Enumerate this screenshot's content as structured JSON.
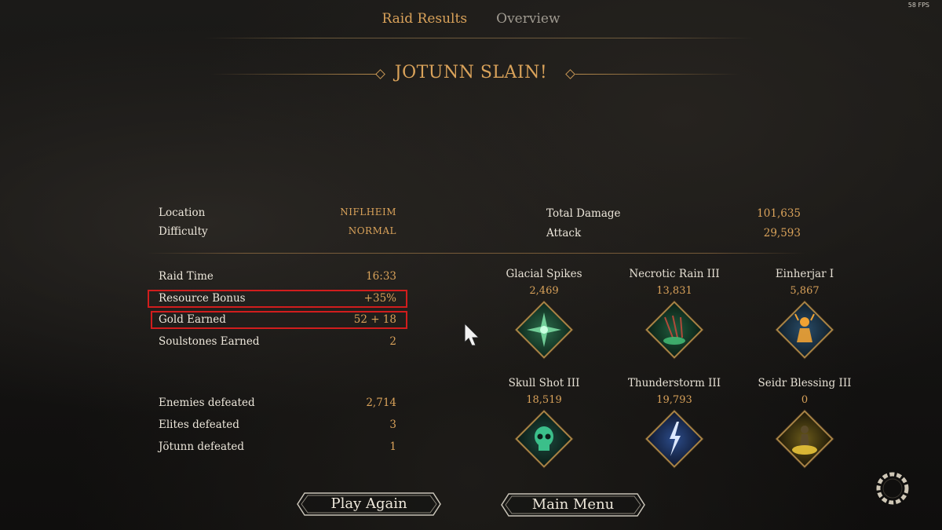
{
  "fps": "58 FPS",
  "tabs": [
    {
      "label": "Raid Results",
      "active": true
    },
    {
      "label": "Overview",
      "active": false
    }
  ],
  "banner_title": "JOTUNN SLAIN!",
  "summary_left": [
    {
      "label": "Location",
      "value": "NIFLHEIM"
    },
    {
      "label": "Difficulty",
      "value": "NORMAL"
    }
  ],
  "summary_right": [
    {
      "label": "Total Damage",
      "value": "101,635"
    },
    {
      "label": "Attack",
      "value": "29,593"
    }
  ],
  "rewards": [
    {
      "label": "Raid Time",
      "value": "16:33",
      "highlighted": false
    },
    {
      "label": "Resource Bonus",
      "value": "+35%",
      "highlighted": true
    },
    {
      "label": "Gold Earned",
      "value": "52 + 18",
      "highlighted": true
    },
    {
      "label": "Soulstones Earned",
      "value": "2",
      "highlighted": false
    }
  ],
  "kills": [
    {
      "label": "Enemies defeated",
      "value": "2,714"
    },
    {
      "label": "Elites defeated",
      "value": "3"
    },
    {
      "label": "Jötunn defeated",
      "value": "1"
    }
  ],
  "abilities": [
    {
      "name": "Glacial Spikes",
      "damage": "2,469",
      "icon": "glacial-spikes-icon",
      "color": "#3fae6e"
    },
    {
      "name": "Necrotic Rain III",
      "damage": "13,831",
      "icon": "necrotic-rain-icon",
      "color": "#47c57a"
    },
    {
      "name": "Einherjar I",
      "damage": "5,867",
      "icon": "einherjar-icon",
      "color": "#f0a233"
    },
    {
      "name": "Skull Shot III",
      "damage": "18,519",
      "icon": "skull-shot-icon",
      "color": "#3bbf8a"
    },
    {
      "name": "Thunderstorm III",
      "damage": "19,793",
      "icon": "thunderstorm-icon",
      "color": "#5e8fe0"
    },
    {
      "name": "Seidr Blessing III",
      "damage": "0",
      "icon": "seidr-blessing-icon",
      "color": "#e9c43a"
    }
  ],
  "buttons": {
    "play_again": "Play Again",
    "main_menu": "Main Menu"
  },
  "colors": {
    "accent_gold": "#d9a25a",
    "highlight_red": "#d11d1d"
  }
}
